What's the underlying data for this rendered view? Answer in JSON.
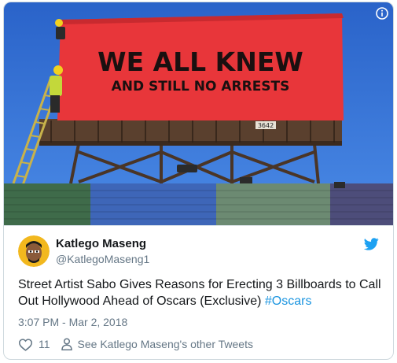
{
  "media": {
    "billboard_line1": "WE ALL KNEW",
    "billboard_line2": "AND STILL NO ARRESTS",
    "billboard_number": "3642",
    "info_icon": "info-icon"
  },
  "author": {
    "name": "Katlego Maseng",
    "handle": "@KatlegoMaseng1",
    "avatar": "avatar-cartoon-face"
  },
  "tweet": {
    "text": "Street Artist Sabo Gives Reasons for Erecting 3 Billboards to Call Out Hollywood Ahead of Oscars (Exclusive) ",
    "hashtag": "#Oscars",
    "timestamp": "3:07 PM - Mar 2, 2018"
  },
  "actions": {
    "like_count": "11",
    "other_tweets_label": "See Katlego Maseng's other Tweets"
  },
  "colors": {
    "link": "#1b95e0",
    "twitter_blue": "#1da1f2",
    "billboard_red": "#e8363a",
    "sky": "#2e6dd6"
  }
}
